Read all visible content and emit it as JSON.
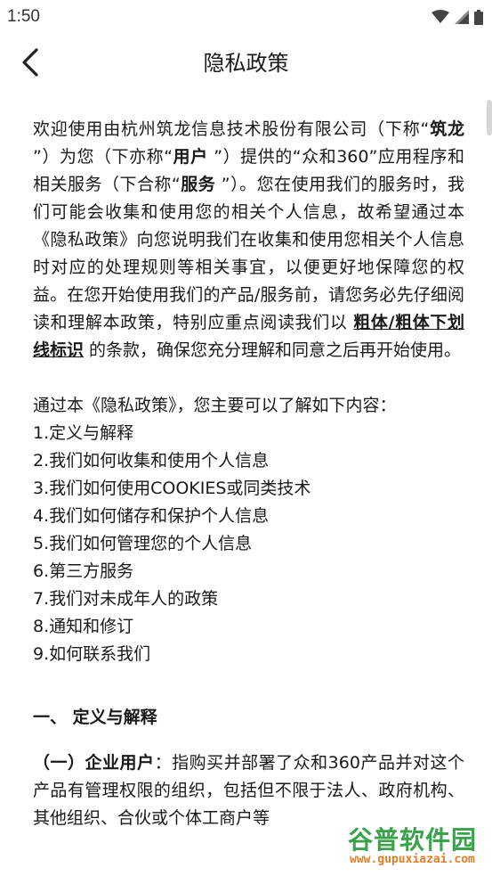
{
  "status_bar": {
    "time": "1:50"
  },
  "app_bar": {
    "title": "隐私政策"
  },
  "intro": {
    "s1": "欢迎使用由杭州筑龙信息技术股份有限公司（下称",
    "s2": "“",
    "s3": "筑龙",
    "s4": " ”）为您（下亦称“",
    "s5": "用户",
    "s6": " ”）提供的“众和360”应用程序和相关服务（下合称“",
    "s7": "服务",
    "s8": " ”）。您在使用我们的服务时，我们可能会收集和使用您的相关个人信息，故希望通过本《隐私政策》向您说明我们在收集和使用您相关个人信息时对应的处理规则等相关事宜，以便更好地保障您的权益。在您开始使用我们的产品/服务前，请您务必先仔细阅读和理解本政策，特别应重点阅读我们以 ",
    "s9": "粗体/粗体下划线标识",
    "s10": " 的条款，确保您充分理解和同意之后再开始使用。"
  },
  "toc": {
    "lead": "通过本《隐私政策》，您主要可以了解如下内容：",
    "items": [
      "1.定义与解释",
      "2.我们如何收集和使用个人信息",
      "3.我们如何使用COOKIES或同类技术",
      "4.我们如何储存和保护个人信息",
      "5.我们如何管理您的个人信息",
      "6.第三方服务",
      "7.我们对未成年人的政策",
      "8.通知和修订",
      "9.如何联系我们"
    ]
  },
  "section1": {
    "heading": "一、 定义与解释",
    "def_number": "（一）",
    "def_term": "企业用户",
    "def_text": "：指购买并部署了众和360产品并对这个产品有管理权限的组织，包括但不限于法人、政府机构、其他组织、合伙或个体工商户等"
  },
  "watermark": {
    "main": "谷普软件园",
    "url": "www.gupuxiazai.com"
  }
}
